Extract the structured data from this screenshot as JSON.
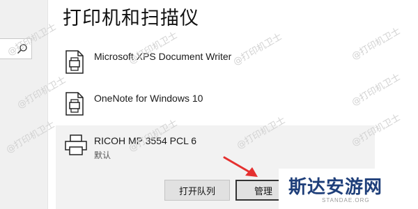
{
  "page": {
    "title": "打印机和扫描仪"
  },
  "sidebar": {
    "search_icon": "search-icon"
  },
  "printers": [
    {
      "name": "Microsoft XPS Document Writer",
      "status": "",
      "icon": "document-printer-icon"
    },
    {
      "name": "OneNote for Windows 10",
      "status": "",
      "icon": "document-printer-icon"
    },
    {
      "name": "RICOH MP 3554 PCL 6",
      "status": "默认",
      "icon": "printer-icon",
      "selected": true
    }
  ],
  "actions": {
    "open_queue": "打开队列",
    "manage": "管理"
  },
  "watermark": {
    "text": "@打印机卫士"
  },
  "brand": {
    "name": "斯达安游网",
    "domain": "STANDAE.ORG"
  },
  "colors": {
    "selected_row": "#f2f2f2",
    "arrow": "#e5302f",
    "brand": "#1f3f7a"
  }
}
